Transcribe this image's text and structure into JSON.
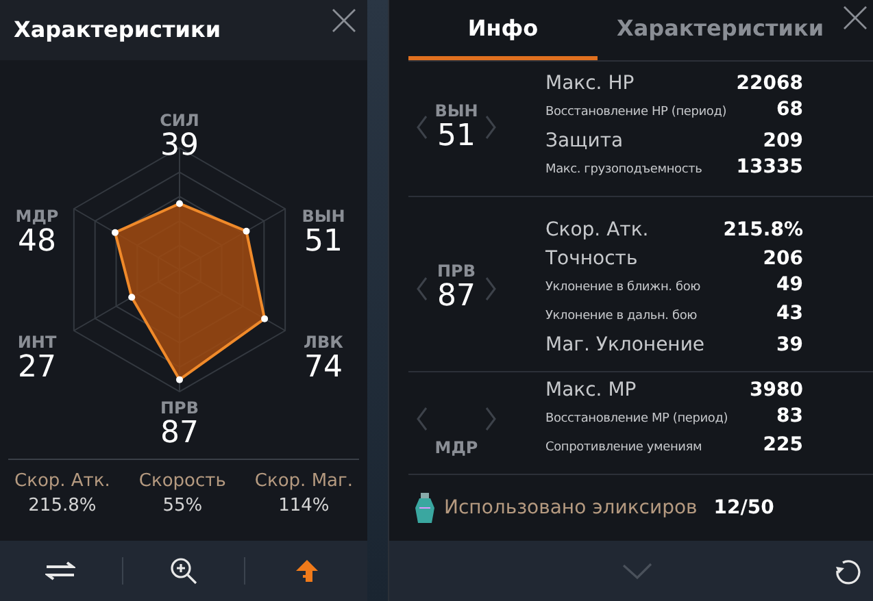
{
  "left_panel": {
    "title": "Характеристики",
    "stats": [
      {
        "label": "СИЛ",
        "value": "39"
      },
      {
        "label": "ВЫН",
        "value": "51"
      },
      {
        "label": "ЛВК",
        "value": "74"
      },
      {
        "label": "ПРВ",
        "value": "87"
      },
      {
        "label": "ИНТ",
        "value": "27"
      },
      {
        "label": "МДР",
        "value": "48"
      }
    ],
    "speeds": [
      {
        "label": "Скор. Атк.",
        "value": "215.8%"
      },
      {
        "label": "Скорость",
        "value": "55%"
      },
      {
        "label": "Скор. Маг.",
        "value": "114%"
      }
    ],
    "toolbar": [
      {
        "kind": "swap",
        "selected": false
      },
      {
        "kind": "zoom",
        "selected": false
      },
      {
        "kind": "upgrade",
        "selected": true
      }
    ]
  },
  "right_panel": {
    "tabs": [
      {
        "label": "Инфо",
        "selected": true
      },
      {
        "label": "Характеристики",
        "selected": false
      }
    ],
    "groups": [
      {
        "stat": "ВЫН",
        "value": "51",
        "rows": [
          {
            "name": "Макс. HP",
            "value": "22068",
            "kind": "large"
          },
          {
            "name": "Восстановление HP (период)",
            "value": "68",
            "kind": "small"
          },
          {
            "name": "Защита",
            "value": "209",
            "kind": "large"
          },
          {
            "name": "Макс. грузоподъемность",
            "value": "13335",
            "kind": "small"
          }
        ]
      },
      {
        "stat": "ПРВ",
        "value": "87",
        "rows": [
          {
            "name": "Скор. Атк.",
            "value": "215.8%",
            "kind": "large"
          },
          {
            "name": "Точность",
            "value": "206",
            "kind": "large"
          },
          {
            "name": "Уклонение в ближн. бою",
            "value": "49",
            "kind": "small"
          },
          {
            "name": "Уклонение в дальн. бою",
            "value": "43",
            "kind": "small"
          },
          {
            "name": "Маг. Уклонение",
            "value": "39",
            "kind": "large"
          }
        ]
      },
      {
        "stat": "МДР",
        "rows": [
          {
            "name": "Макс. MP",
            "value": "3980",
            "kind": "large"
          },
          {
            "name": "Восстановление MP (период)",
            "value": "83",
            "kind": "small"
          },
          {
            "name": "Сопротивление умениям",
            "value": "225",
            "kind": "small"
          }
        ]
      }
    ],
    "elixirs": {
      "label": "Использовано эликсиров",
      "count": "12/50"
    }
  }
}
